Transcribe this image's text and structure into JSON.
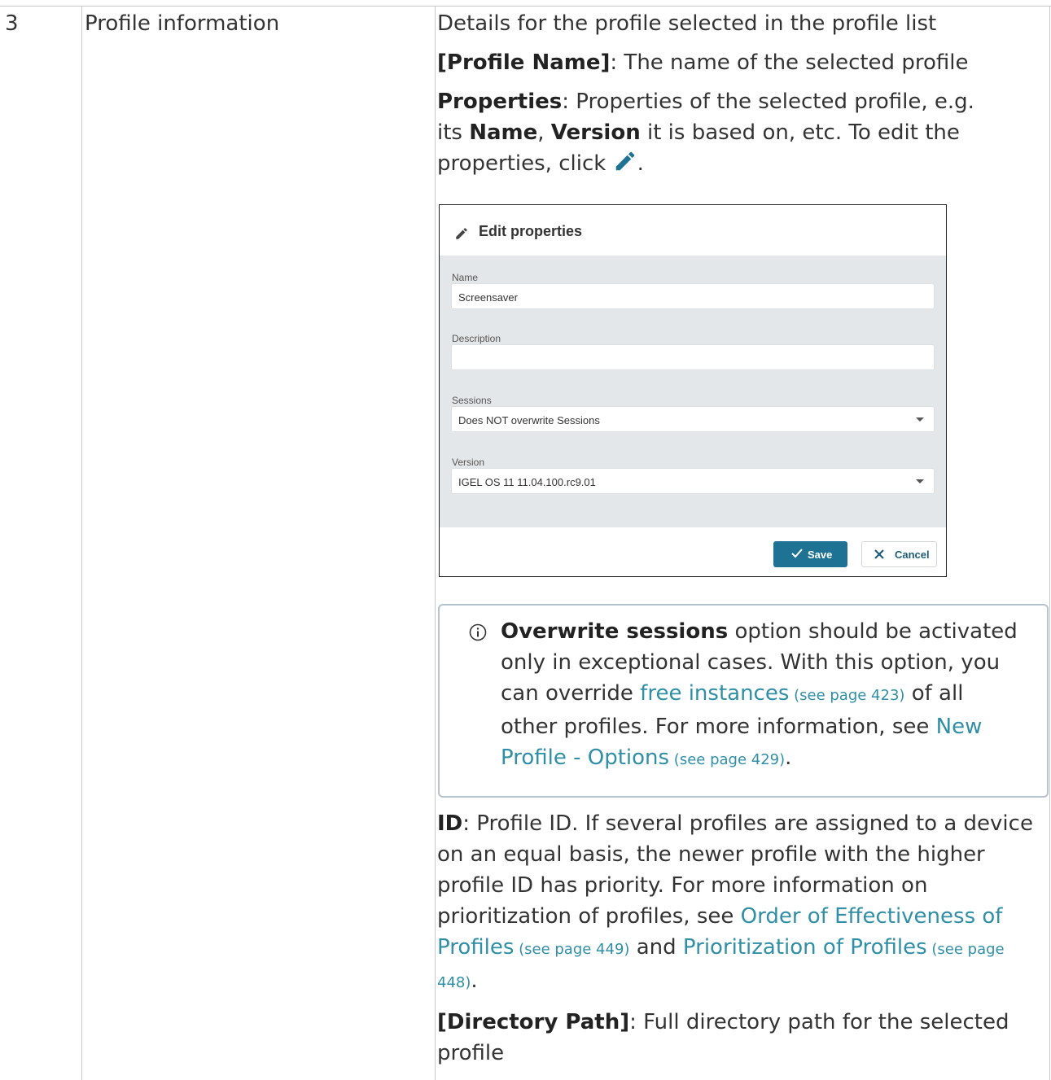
{
  "row": {
    "number": "3",
    "area": "Profile information"
  },
  "desc": {
    "intro": "Details for the profile selected in the profile list",
    "profile_name_label": "[Profile Name]",
    "profile_name_text": ": The name of the selected profile",
    "properties_label": "Properties",
    "properties_text_1": ": Properties of the selected profile, e.g.",
    "properties_text_2a": "its ",
    "properties_name": "Name",
    "comma": ", ",
    "properties_version": "Version",
    "properties_text_2b": " it is based on, etc. To edit the",
    "properties_text_3": "properties, click ",
    "period": "."
  },
  "dialog": {
    "title": "Edit properties",
    "name_label": "Name",
    "name_value": "Screensaver",
    "description_label": "Description",
    "description_value": "",
    "sessions_label": "Sessions",
    "sessions_value": "Does NOT overwrite Sessions",
    "version_label": "Version",
    "version_value": "IGEL OS 11 11.04.100.rc9.01",
    "save_label": "Save",
    "cancel_label": "Cancel"
  },
  "info": {
    "bold": "Overwrite sessions",
    "t1": " option should be activated",
    "t2": "only in exceptional cases. With this option, you",
    "t3a": "can override ",
    "link1": "free instances",
    "ref1": " (see page 423)",
    "t3b": " of all",
    "t4a": "other profiles. For more information, see ",
    "link2a": "New",
    "link2b": "Profile - Options",
    "ref2": " (see page 429)",
    "t5": "."
  },
  "id_section": {
    "label": "ID",
    "l1": ": Profile ID. If several profiles are assigned to a device",
    "l2": "on an equal basis, the newer profile with the higher",
    "l3": "profile ID has priority. For more information on",
    "l4a": "prioritization of profiles, see ",
    "link1a": "Order of Effectiveness of",
    "link1b": "Profiles",
    "ref1": " (see page 449)",
    "and": " and ",
    "link2": "Prioritization of Profiles",
    "ref2a": " (see page",
    "ref2b": "448)",
    "end": "."
  },
  "dir_section": {
    "label": "[Directory Path]",
    "l1": ": Full directory path for the selected",
    "l2": "profile"
  },
  "colors": {
    "accent": "#1e7394",
    "link": "#2f8fa6",
    "info_border": "#b6c3cf"
  }
}
